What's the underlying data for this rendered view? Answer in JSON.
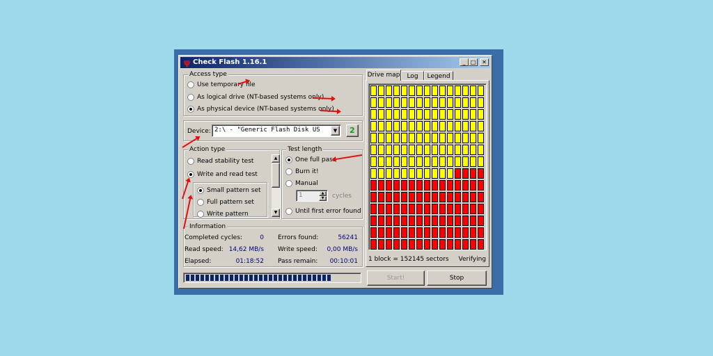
{
  "window": {
    "title": "Check Flash 1.16.1",
    "minimize": "_",
    "maximize": "□",
    "close": "✕"
  },
  "access_type": {
    "title": "Access type",
    "options": [
      {
        "label": "Use temporary file",
        "selected": false
      },
      {
        "label": "As logical drive (NT-based systems only)",
        "selected": false
      },
      {
        "label": "As physical device (NT-based systems only)",
        "selected": true
      }
    ]
  },
  "device": {
    "label": "Device:",
    "value": "2:\\ - \"Generic Flash Disk US",
    "refresh_icon": "refresh-icon"
  },
  "action_type": {
    "title": "Action type",
    "options": [
      {
        "label": "Read stability test",
        "selected": false
      },
      {
        "label": "Write and read test",
        "selected": true
      }
    ],
    "sub_options": [
      {
        "label": "Small pattern set",
        "selected": true
      },
      {
        "label": "Full pattern set",
        "selected": false
      },
      {
        "label": "Write pattern",
        "selected": false
      }
    ]
  },
  "test_length": {
    "title": "Test length",
    "options": [
      {
        "label": "One full pass",
        "selected": true
      },
      {
        "label": "Burn it!",
        "selected": false
      },
      {
        "label": "Manual",
        "selected": false
      }
    ],
    "cycles_value": "1",
    "cycles_label": "cycles",
    "until_error": {
      "label": "Until first error found",
      "selected": false
    }
  },
  "information": {
    "title": "Information",
    "completed_cycles_label": "Completed cycles:",
    "completed_cycles": "0",
    "errors_found_label": "Errors found:",
    "errors_found": "56241",
    "read_speed_label": "Read speed:",
    "read_speed": "14,62 MB/s",
    "write_speed_label": "Write speed:",
    "write_speed": "0,00 MB/s",
    "elapsed_label": "Elapsed:",
    "elapsed": "01:18:52",
    "pass_remain_label": "Pass remain:",
    "pass_remain": "00:10:01"
  },
  "progress": {
    "segments": 30
  },
  "buttons": {
    "start": "Start!",
    "stop": "Stop"
  },
  "tabs": [
    {
      "label": "Drive map",
      "active": true
    },
    {
      "label": "Log",
      "active": false
    },
    {
      "label": "Legend",
      "active": false
    }
  ],
  "drive_map": {
    "columns": 15,
    "rows": 14,
    "yellow_blocks": 116,
    "colors": {
      "ok": "#ffff00",
      "error": "#ff0000"
    },
    "block_info": "1 block = 152145 sectors",
    "status": "Verifying"
  }
}
